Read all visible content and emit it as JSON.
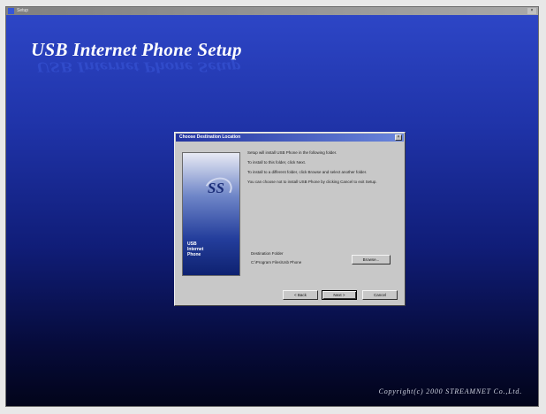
{
  "window": {
    "title": "Setup",
    "close_glyph": "×"
  },
  "background": {
    "title": "USB Internet Phone Setup",
    "copyright": "Copyright(c) 2000 STREAMNET Co.,Ltd."
  },
  "dialog": {
    "title": "Choose Destination Location",
    "close_glyph": "×",
    "side_caption": [
      "USB",
      "Internet",
      "Phone"
    ],
    "paragraphs": [
      "Setup will install USB Phone in the following folder.",
      "To install to this folder, click Next.",
      "To install to a different folder, click Browse and select another folder.",
      "You can choose not to install USB Phone by clicking Cancel to exit Setup."
    ],
    "destination": {
      "label": "Destination Folder",
      "path": "C:\\Program Files\\Usb Phone",
      "browse_label": "Browse..."
    },
    "buttons": {
      "back": "< Back",
      "next": "Next >",
      "cancel": "Cancel"
    }
  },
  "colors": {
    "background_top": "#2e47c8",
    "background_bottom": "#02041a",
    "dialog_face": "#c8c8c8",
    "dialog_titlebar": "#2233a0"
  }
}
